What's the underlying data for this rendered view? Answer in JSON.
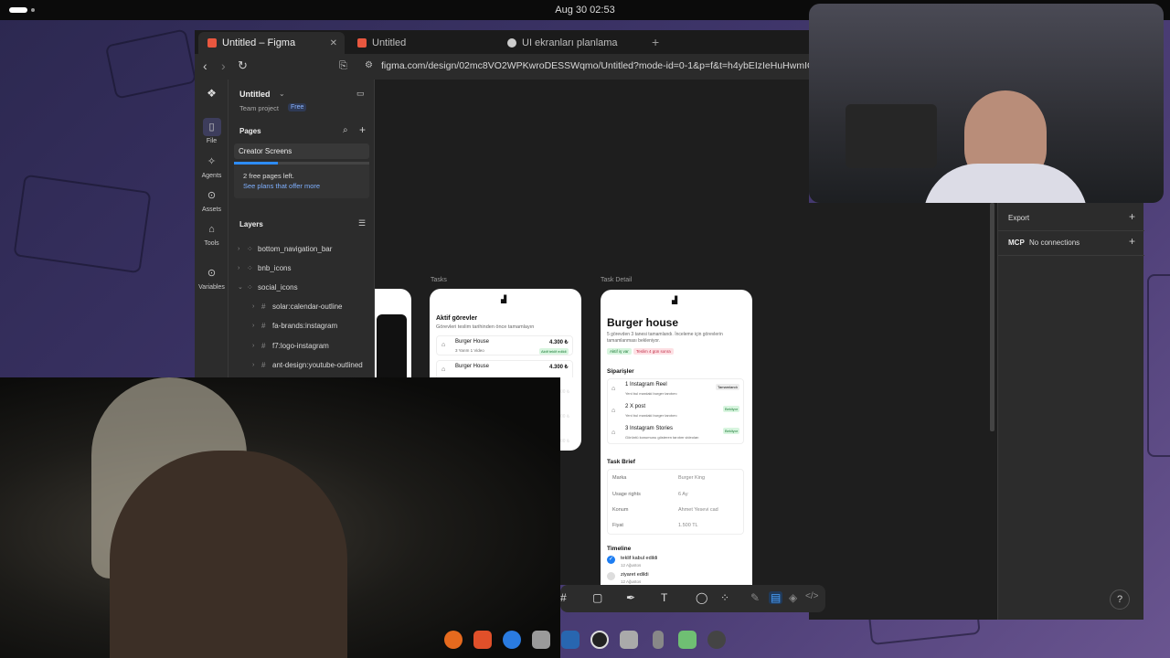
{
  "system": {
    "clock": "Aug 30  02:53"
  },
  "browser": {
    "tabs": [
      {
        "label": "Untitled – Figma",
        "active": true,
        "fav_color": "#e8573f"
      },
      {
        "label": "Untitled",
        "active": false,
        "fav_color": "#e8573f"
      },
      {
        "label": "UI ekranları planlama",
        "active": false,
        "fav_color": "#cccccc"
      }
    ],
    "new_tab": "+",
    "url": "figma.com/design/02mc8VO2WPKwroDESSWqmo/Untitled?mode-id=0-1&p=f&t=h4ybEIzIeHuHwmIO-0"
  },
  "figma": {
    "rail": [
      {
        "label": "File",
        "icon": "file-icon",
        "glyph": "▯",
        "selected": true
      },
      {
        "label": "Agents",
        "icon": "agents-icon",
        "glyph": "✧",
        "selected": false
      },
      {
        "label": "Assets",
        "icon": "assets-icon",
        "glyph": "⊙",
        "selected": false
      },
      {
        "label": "Tools",
        "icon": "tools-icon",
        "glyph": "⌂",
        "selected": false
      },
      {
        "label": "Variables",
        "icon": "variables-icon",
        "glyph": "⊙",
        "selected": false
      }
    ],
    "file_name": "Untitled",
    "team": "Team project",
    "plan_badge": "Free",
    "pages_title": "Pages",
    "current_page": "Creator Screens",
    "free_pages_note": "2 free pages left.",
    "plans_link": "See plans that offer more",
    "layers_title": "Layers",
    "layers": [
      {
        "name": "bottom_navigation_bar",
        "indent": 0
      },
      {
        "name": "bnb_icons",
        "indent": 0
      },
      {
        "name": "social_icons",
        "indent": 0
      },
      {
        "name": "solar:calendar-outline",
        "indent": 1
      },
      {
        "name": "fa-brands:instagram",
        "indent": 1
      },
      {
        "name": "f7:logo-instagram",
        "indent": 1
      },
      {
        "name": "ant-design:youtube-outlined",
        "indent": 1
      }
    ],
    "frames": {
      "tasks_label": "Tasks",
      "detail_label": "Task Detail",
      "tasks": {
        "heading": "Aktif görevler",
        "sub": "Görevleri teslim tarihinden önce tamamlayın",
        "items": [
          {
            "name": "Burger House",
            "meta": "3 Yarım   1 Video",
            "price": "4.300 ₺",
            "badge": "Aktif teklif edildi"
          },
          {
            "name": "Burger House",
            "meta": "",
            "price": "4.300 ₺",
            "badge": ""
          }
        ]
      },
      "detail": {
        "title": "Burger house",
        "desc": "5 görevden 3 tanesi tamamlandı. İnceleme için görevlerin tamamlanması bekleniyor.",
        "tag1": "Aktif iş var",
        "tag2": "Teslim 4 gün sonra",
        "orders_title": "Siparişler",
        "orders": [
          {
            "name": "1 Instagram Reel",
            "sub": "Yeni bul mardaki burger tanıtımı",
            "badge": "Tamamlandı"
          },
          {
            "name": "2 X post",
            "sub": "Yeni bul mardaki burger tanıtımı",
            "badge": "Bekliyor"
          },
          {
            "name": "3 Instagram Stories",
            "sub": "Görüntü konumunu gösteren tanıtım videoları",
            "badge": "Bekliyor"
          }
        ],
        "brief_title": "Task Brief",
        "brief": [
          {
            "k": "Marka",
            "v": "Burger King"
          },
          {
            "k": "Usage rights",
            "v": "6 Ay"
          },
          {
            "k": "Konum",
            "v": "Ahmet Yesevi cad"
          },
          {
            "k": "Fiyat",
            "v": "1.500 TL"
          }
        ],
        "timeline_title": "Timeline",
        "timeline": [
          {
            "label": "teklif kabul edildi",
            "date": "12 Ağustos",
            "done": true
          },
          {
            "label": "ziyaret edildi",
            "date": "12 Ağustos",
            "done": false
          }
        ]
      }
    },
    "right": {
      "export": "Export",
      "mcp": "MCP",
      "mcp_status": "No connections"
    },
    "help": "?"
  }
}
